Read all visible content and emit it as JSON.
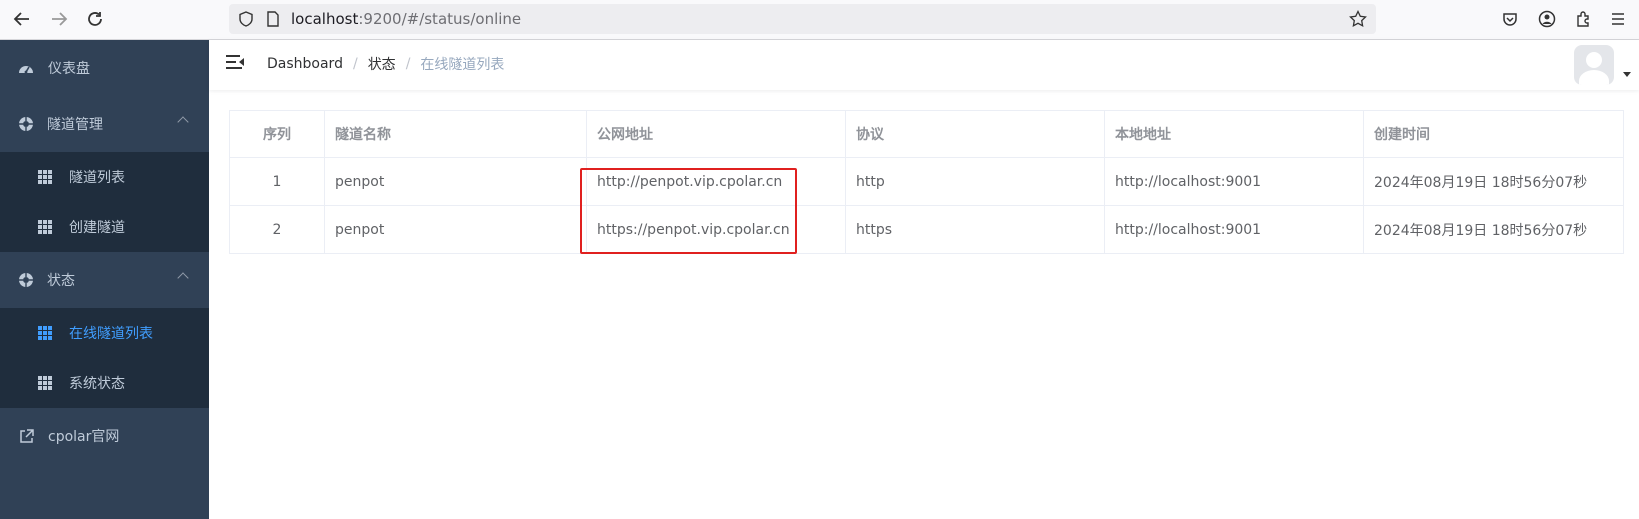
{
  "browser": {
    "url_host": "localhost",
    "url_rest": ":9200/#/status/online"
  },
  "sidebar": {
    "dashboard": "仪表盘",
    "tunnel_mgmt": "隧道管理",
    "tunnel_list": "隧道列表",
    "create_tunnel": "创建隧道",
    "status": "状态",
    "online_list": "在线隧道列表",
    "system_status": "系统状态",
    "cpolar_site": "cpolar官网"
  },
  "breadcrumb": {
    "item1": "Dashboard",
    "item2": "状态",
    "item3": "在线隧道列表",
    "separator": "/"
  },
  "table": {
    "headers": [
      "序列",
      "隧道名称",
      "公网地址",
      "协议",
      "本地地址",
      "创建时间"
    ],
    "rows": [
      [
        "1",
        "penpot",
        "http://penpot.vip.cpolar.cn",
        "http",
        "http://localhost:9001",
        "2024年08月19日 18时56分07秒"
      ],
      [
        "2",
        "penpot",
        "https://penpot.vip.cpolar.cn",
        "https",
        "http://localhost:9001",
        "2024年08月19日 18时56分07秒"
      ]
    ]
  },
  "colors": {
    "sidebar_bg": "#304156",
    "submenu_bg": "#1f2d3d",
    "active": "#409eff",
    "highlight": "#e0201f"
  }
}
